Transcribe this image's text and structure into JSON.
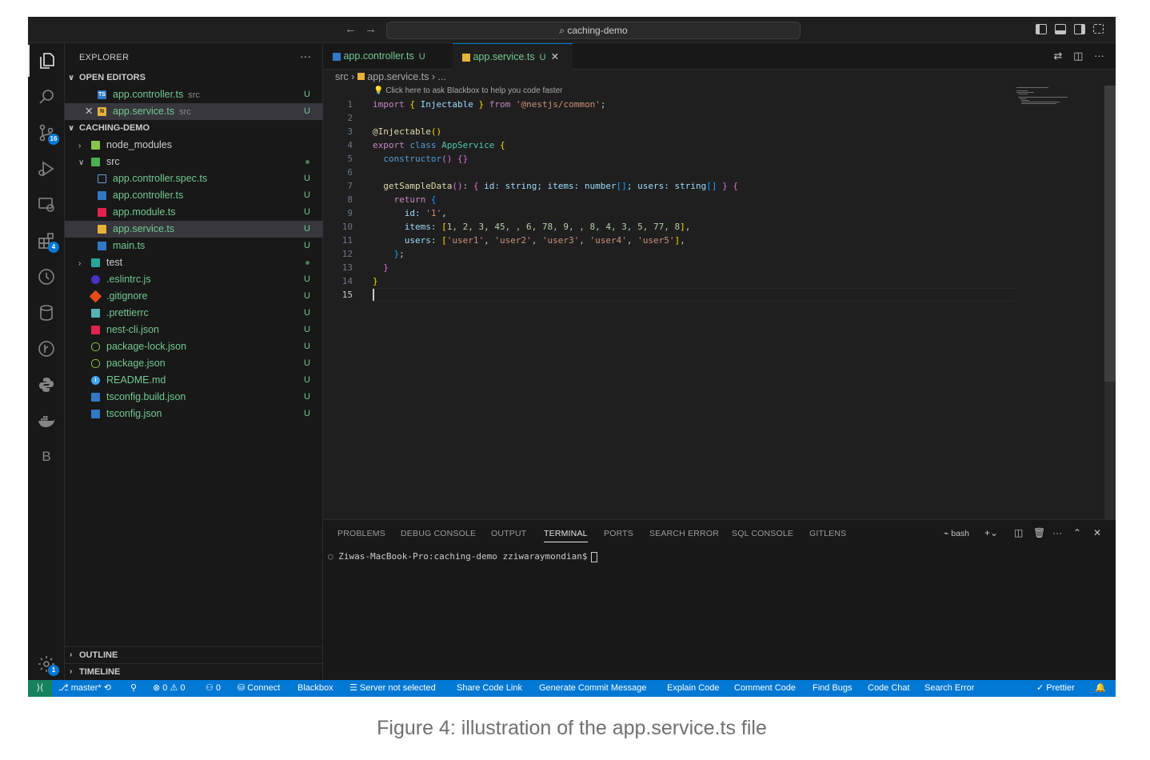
{
  "titlebar": {
    "search_text": "caching-demo",
    "back_icon": "arrow-left-icon",
    "forward_icon": "arrow-right-icon"
  },
  "activity_bar": {
    "items": [
      {
        "name": "explorer-icon"
      },
      {
        "name": "search-icon"
      },
      {
        "name": "source-control-icon",
        "badge": "16"
      },
      {
        "name": "run-debug-icon"
      },
      {
        "name": "remote-explorer-icon"
      },
      {
        "name": "extensions-icon",
        "badge": "4"
      },
      {
        "name": "timeline-icon"
      },
      {
        "name": "database-icon"
      },
      {
        "name": "gitlens-icon"
      },
      {
        "name": "python-icon"
      },
      {
        "name": "docker-icon"
      },
      {
        "name": "blackbox-icon",
        "label": "B"
      }
    ],
    "settings_badge": "1"
  },
  "sidebar": {
    "title": "EXPLORER",
    "more": "···",
    "open_editors_label": "OPEN EDITORS",
    "open_editors": [
      {
        "name": "app.controller.ts",
        "desc": "src",
        "status": "U"
      },
      {
        "name": "app.service.ts",
        "desc": "src",
        "status": "U"
      }
    ],
    "project_label": "CACHING-DEMO",
    "tree": [
      {
        "name": "node_modules",
        "status": ""
      },
      {
        "name": "src",
        "status": ""
      },
      {
        "name": "app.controller.spec.ts",
        "status": "U"
      },
      {
        "name": "app.controller.ts",
        "status": "U"
      },
      {
        "name": "app.module.ts",
        "status": "U"
      },
      {
        "name": "app.service.ts",
        "status": "U"
      },
      {
        "name": "main.ts",
        "status": "U"
      },
      {
        "name": "test",
        "status": ""
      },
      {
        "name": ".eslintrc.js",
        "status": "U"
      },
      {
        "name": ".gitignore",
        "status": "U"
      },
      {
        "name": ".prettierrc",
        "status": "U"
      },
      {
        "name": "nest-cli.json",
        "status": "U"
      },
      {
        "name": "package-lock.json",
        "status": "U"
      },
      {
        "name": "package.json",
        "status": "U"
      },
      {
        "name": "README.md",
        "status": "U"
      },
      {
        "name": "tsconfig.build.json",
        "status": "U"
      },
      {
        "name": "tsconfig.json",
        "status": "U"
      }
    ],
    "outline_label": "OUTLINE",
    "timeline_label": "TIMELINE"
  },
  "tabs": [
    {
      "label": "app.controller.ts",
      "status": "U"
    },
    {
      "label": "app.service.ts",
      "status": "U"
    }
  ],
  "breadcrumb": {
    "folder": "src",
    "file": "app.service.ts",
    "rest": "..."
  },
  "blackbox_hint": "Click here to ask Blackbox to help you code faster",
  "line_numbers": [
    "1",
    "2",
    "3",
    "4",
    "5",
    "6",
    "7",
    "8",
    "9",
    "10",
    "11",
    "12",
    "13",
    "14",
    "15"
  ],
  "code": {
    "l1": [
      "import",
      " ",
      "{",
      " Injectable ",
      "}",
      " ",
      "from",
      " ",
      "'@nestjs/common'",
      ";"
    ],
    "l3": [
      "@",
      "Injectable",
      "(",
      ")"
    ],
    "l4": [
      "export",
      " ",
      "class",
      " ",
      "AppService",
      " ",
      "{"
    ],
    "l5": [
      "  ",
      "constructor",
      "(",
      ")",
      " ",
      "{",
      "}"
    ],
    "l7": [
      "  ",
      "getSampleData",
      "(",
      ")",
      ": ",
      "{",
      " id: string; items: number",
      "[]",
      "; users: string",
      "[]",
      " ",
      "}",
      " ",
      "{"
    ],
    "l8": [
      "    ",
      "return",
      " ",
      "{"
    ],
    "l9": [
      "      id: ",
      "'1'",
      ","
    ],
    "l10": [
      "      items: ",
      "[",
      "1, 2, 3, 45, , 6, 78, 9, , 8, 4, 3, 5, 77, 8",
      "]",
      ","
    ],
    "l11": [
      "      users: ",
      "[",
      "'user1'",
      ", ",
      "'user2'",
      ", ",
      "'user3'",
      ", ",
      "'user4'",
      ", ",
      "'user5'",
      "]",
      ","
    ],
    "l12": [
      "    ",
      "}",
      ";"
    ],
    "l13": [
      "  ",
      "}"
    ],
    "l14": [
      "}"
    ]
  },
  "panel": {
    "tabs": [
      "PROBLEMS",
      "DEBUG CONSOLE",
      "OUTPUT",
      "TERMINAL",
      "PORTS",
      "SEARCH ERROR",
      "SQL CONSOLE",
      "GITLENS"
    ],
    "active_tab": "TERMINAL",
    "shell": "bash",
    "terminal_line": "Ziwas-MacBook-Pro:caching-demo zziwaraymondian$"
  },
  "statusbar": {
    "branch": "master*",
    "errors": "0",
    "warnings": "0",
    "ports": "0",
    "connect": "Connect",
    "blackbox": "Blackbox",
    "server": "Server not selected",
    "share": "Share Code Link",
    "commit": "Generate Commit Message",
    "explain": "Explain Code",
    "comment": "Comment Code",
    "bugs": "Find Bugs",
    "chat": "Code Chat",
    "search_error": "Search Error",
    "prettier": "Prettier"
  },
  "caption": "Figure 4: illustration of the app.service.ts file",
  "colors": {
    "accent": "#0078d4",
    "status_bar": "#0078d4",
    "remote": "#16825d",
    "untracked": "#73c991"
  }
}
